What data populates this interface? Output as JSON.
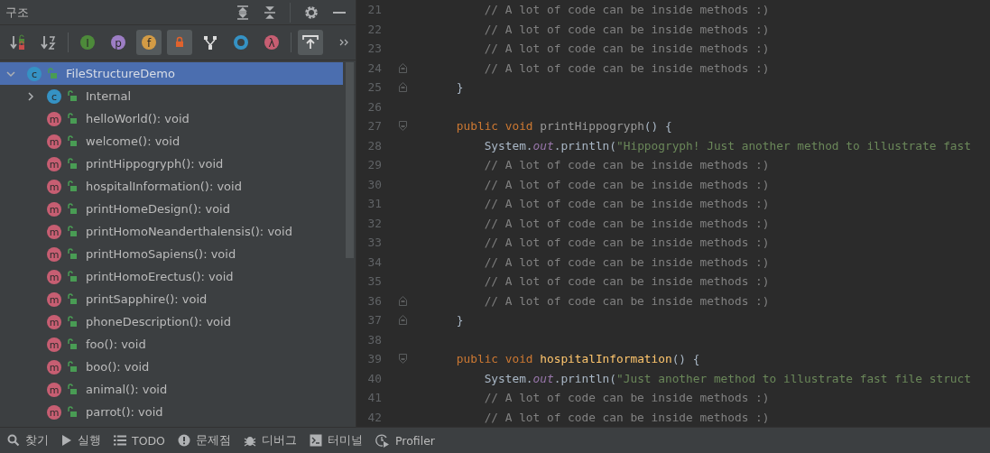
{
  "structure_panel": {
    "title": "구조",
    "toolbar": {
      "groups": [
        [
          {
            "kind": "sort-visibility",
            "on": false
          },
          {
            "kind": "sort-alpha",
            "on": false
          }
        ],
        [
          {
            "kind": "letter",
            "glyph": "I",
            "color": "#4d8a3a",
            "on": false
          },
          {
            "kind": "letter",
            "glyph": "p",
            "color": "#9d7ec5",
            "on": false
          },
          {
            "kind": "letter",
            "glyph": "f",
            "color": "#d39b45",
            "on": true
          },
          {
            "kind": "lock",
            "on": true
          },
          {
            "kind": "hierarchy",
            "on": false
          },
          {
            "kind": "ring",
            "color": "#3592c4",
            "on": false
          },
          {
            "kind": "letter",
            "glyph": "λ",
            "color": "#c75e72",
            "on": false
          }
        ],
        [
          {
            "kind": "autoscroll",
            "on": true
          }
        ]
      ]
    },
    "tree": [
      {
        "kind": "class",
        "glyph": "c",
        "label": "FileStructureDemo",
        "selected": true,
        "expanded": true,
        "children": [
          {
            "kind": "class",
            "glyph": "c",
            "label": "Internal",
            "selected": false,
            "expanded": false
          },
          {
            "kind": "method",
            "glyph": "m",
            "label": "helloWorld(): void",
            "selected": false
          },
          {
            "kind": "method",
            "glyph": "m",
            "label": "welcome(): void",
            "selected": false
          },
          {
            "kind": "method",
            "glyph": "m",
            "label": "printHippogryph(): void",
            "selected": false
          },
          {
            "kind": "method",
            "glyph": "m",
            "label": "hospitalInformation(): void",
            "selected": false
          },
          {
            "kind": "method",
            "glyph": "m",
            "label": "printHomeDesign(): void",
            "selected": false
          },
          {
            "kind": "method",
            "glyph": "m",
            "label": "printHomoNeanderthalensis(): void",
            "selected": false
          },
          {
            "kind": "method",
            "glyph": "m",
            "label": "printHomoSapiens(): void",
            "selected": false
          },
          {
            "kind": "method",
            "glyph": "m",
            "label": "printHomoErectus(): void",
            "selected": false
          },
          {
            "kind": "method",
            "glyph": "m",
            "label": "printSapphire(): void",
            "selected": false
          },
          {
            "kind": "method",
            "glyph": "m",
            "label": "phoneDescription(): void",
            "selected": false
          },
          {
            "kind": "method",
            "glyph": "m",
            "label": "foo(): void",
            "selected": false
          },
          {
            "kind": "method",
            "glyph": "m",
            "label": "boo(): void",
            "selected": false
          },
          {
            "kind": "method",
            "glyph": "m",
            "label": "animal(): void",
            "selected": false
          },
          {
            "kind": "method",
            "glyph": "m",
            "label": "parrot(): void",
            "selected": false
          }
        ]
      }
    ]
  },
  "editor": {
    "lines": [
      {
        "number": "21",
        "kind": "statement",
        "tokens": [
          {
            "kind": "comment",
            "text": "// A lot of code can be inside methods :)"
          }
        ]
      },
      {
        "number": "22",
        "kind": "statement",
        "tokens": [
          {
            "kind": "comment",
            "text": "// A lot of code can be inside methods :)"
          }
        ]
      },
      {
        "number": "23",
        "kind": "statement",
        "tokens": [
          {
            "kind": "comment",
            "text": "// A lot of code can be inside methods :)"
          }
        ]
      },
      {
        "number": "24",
        "kind": "statement",
        "fold_marker": {
          "kind": "end"
        },
        "tokens": [
          {
            "kind": "comment",
            "text": "// A lot of code can be inside methods :)"
          }
        ]
      },
      {
        "number": "25",
        "kind": "member",
        "fold_marker": {
          "kind": "end"
        },
        "tokens": [
          {
            "kind": "plain",
            "text": "}"
          }
        ]
      },
      {
        "number": "26"
      },
      {
        "number": "27",
        "kind": "member",
        "fold_marker": {
          "kind": "start"
        },
        "tokens": [
          {
            "kind": "keyword",
            "text": "public void "
          },
          {
            "kind": "unused",
            "text": "printHippogryph"
          },
          {
            "kind": "plain",
            "text": "() {"
          }
        ]
      },
      {
        "number": "28",
        "kind": "statement",
        "tokens": [
          {
            "kind": "plain",
            "text": "System."
          },
          {
            "kind": "field",
            "text": "out"
          },
          {
            "kind": "plain",
            "text": ".println("
          },
          {
            "kind": "string",
            "text": "\"Hippogryph! Just another method to illustrate fast"
          }
        ]
      },
      {
        "number": "29",
        "kind": "statement",
        "tokens": [
          {
            "kind": "comment",
            "text": "// A lot of code can be inside methods :)"
          }
        ]
      },
      {
        "number": "30",
        "kind": "statement",
        "tokens": [
          {
            "kind": "comment",
            "text": "// A lot of code can be inside methods :)"
          }
        ]
      },
      {
        "number": "31",
        "kind": "statement",
        "tokens": [
          {
            "kind": "comment",
            "text": "// A lot of code can be inside methods :)"
          }
        ]
      },
      {
        "number": "32",
        "kind": "statement",
        "tokens": [
          {
            "kind": "comment",
            "text": "// A lot of code can be inside methods :)"
          }
        ]
      },
      {
        "number": "33",
        "kind": "statement",
        "tokens": [
          {
            "kind": "comment",
            "text": "// A lot of code can be inside methods :)"
          }
        ]
      },
      {
        "number": "34",
        "kind": "statement",
        "tokens": [
          {
            "kind": "comment",
            "text": "// A lot of code can be inside methods :)"
          }
        ]
      },
      {
        "number": "35",
        "kind": "statement",
        "tokens": [
          {
            "kind": "comment",
            "text": "// A lot of code can be inside methods :)"
          }
        ]
      },
      {
        "number": "36",
        "kind": "statement",
        "fold_marker": {
          "kind": "end"
        },
        "tokens": [
          {
            "kind": "comment",
            "text": "// A lot of code can be inside methods :)"
          }
        ]
      },
      {
        "number": "37",
        "kind": "member",
        "fold_marker": {
          "kind": "end"
        },
        "tokens": [
          {
            "kind": "plain",
            "text": "}"
          }
        ]
      },
      {
        "number": "38"
      },
      {
        "number": "39",
        "kind": "member",
        "fold_marker": {
          "kind": "start"
        },
        "tokens": [
          {
            "kind": "keyword",
            "text": "public void "
          },
          {
            "kind": "method",
            "text": "hospitalInformation"
          },
          {
            "kind": "plain",
            "text": "() {"
          }
        ]
      },
      {
        "number": "40",
        "kind": "statement",
        "tokens": [
          {
            "kind": "plain",
            "text": "System."
          },
          {
            "kind": "field",
            "text": "out"
          },
          {
            "kind": "plain",
            "text": ".println("
          },
          {
            "kind": "string",
            "text": "\"Just another method to illustrate fast file struct"
          }
        ]
      },
      {
        "number": "41",
        "kind": "statement",
        "tokens": [
          {
            "kind": "comment",
            "text": "// A lot of code can be inside methods :)"
          }
        ]
      },
      {
        "number": "42",
        "kind": "statement",
        "tokens": [
          {
            "kind": "comment",
            "text": "// A lot of code can be inside methods :)"
          }
        ]
      }
    ]
  },
  "bottom_bar": [
    {
      "kind": "search",
      "label": "찾기"
    },
    {
      "kind": "run",
      "label": "실행"
    },
    {
      "kind": "todo",
      "label": "TODO"
    },
    {
      "kind": "problems",
      "label": "문제점"
    },
    {
      "kind": "debug",
      "label": "디버그"
    },
    {
      "kind": "terminal",
      "label": "터미널"
    },
    {
      "kind": "profiler",
      "label": "Profiler"
    }
  ]
}
